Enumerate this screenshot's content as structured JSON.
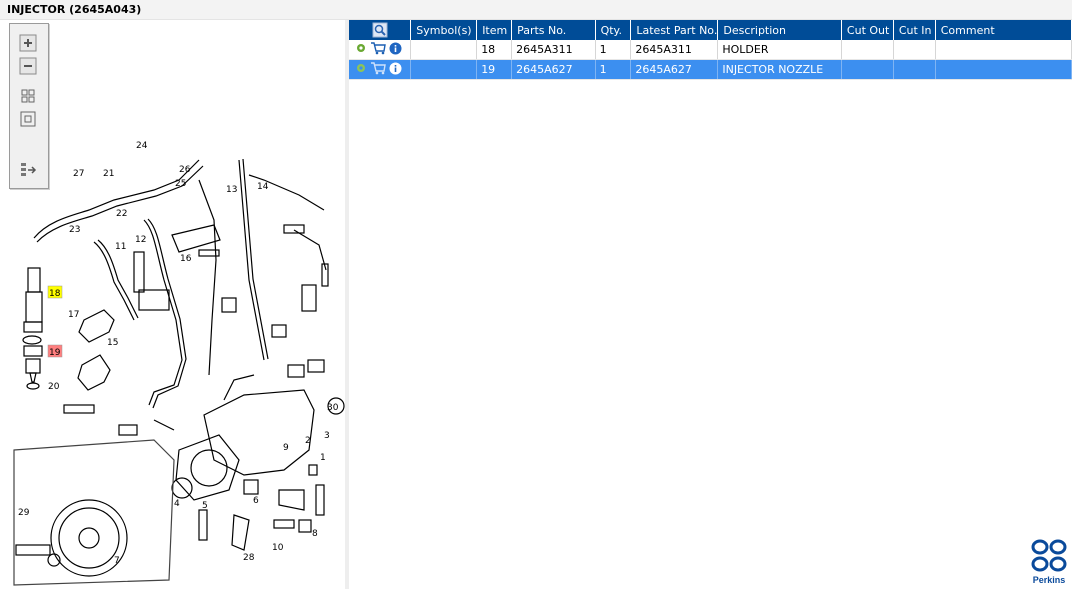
{
  "window": {
    "title": "INJECTOR (2645A043)"
  },
  "zoom_toolbar": {
    "buttons": [
      {
        "name": "zoom-in",
        "icon": "plus-icon"
      },
      {
        "name": "zoom-out",
        "icon": "minus-icon"
      },
      {
        "name": "fit-page",
        "icon": "grid-icon"
      },
      {
        "name": "actual-size",
        "icon": "square-icon"
      },
      {
        "name": "export",
        "icon": "export-icon"
      }
    ]
  },
  "diagram": {
    "callouts": [
      "24",
      "27",
      "21",
      "26",
      "25",
      "13",
      "14",
      "22",
      "23",
      "12",
      "11",
      "16",
      "18",
      "17",
      "19",
      "15",
      "20",
      "30",
      "3",
      "2",
      "1",
      "9",
      "6",
      "4",
      "5",
      "8",
      "29",
      "10",
      "28",
      "7"
    ],
    "highlight_colors": {
      "18": "#ffff00",
      "19": "#ff7f7f"
    }
  },
  "grid": {
    "columns": [
      "",
      "Symbol(s)",
      "Item",
      "Parts No.",
      "Qty.",
      "Latest Part No.",
      "Description",
      "Cut Out",
      "Cut In",
      "Comment"
    ],
    "rows": [
      {
        "item": "18",
        "parts_no": "2645A311",
        "qty": "1",
        "latest_part_no": "2645A311",
        "description": "HOLDER",
        "symbols": "",
        "cut_out": "",
        "cut_in": "",
        "comment": "",
        "selected": false
      },
      {
        "item": "19",
        "parts_no": "2645A627",
        "qty": "1",
        "latest_part_no": "2645A627",
        "description": "INJECTOR NOZZLE",
        "symbols": "",
        "cut_out": "",
        "cut_in": "",
        "comment": "",
        "selected": true
      }
    ],
    "row_icons": [
      "gear-icon",
      "cart-icon",
      "info-icon"
    ]
  },
  "colors": {
    "header_bg": "#004c97",
    "selected_row": "#3c8ff0",
    "brand": "#0a4a9b"
  },
  "brand": {
    "name": "Perkins"
  }
}
